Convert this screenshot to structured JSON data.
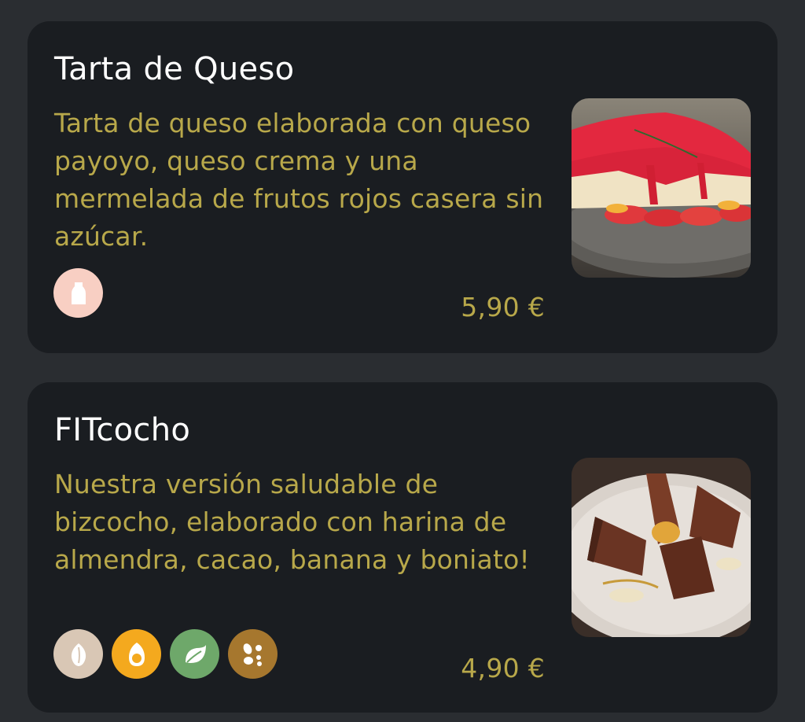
{
  "colors": {
    "page_background": "#2a2d31",
    "card_background": "#1a1d21",
    "title": "#ffffff",
    "accent": "#b8a84a"
  },
  "products": [
    {
      "title": "Tarta de Queso",
      "description": "Tarta de queso elaborada con queso payoyo, queso crema y una mermelada de frutos rojos casera sin azúcar.",
      "price": "5,90 €",
      "image": "cheesecake-photo",
      "allergens": [
        {
          "icon": "milk-bottle-icon",
          "color": "#f8cfc3"
        }
      ]
    },
    {
      "title": "FITcocho",
      "description": "Nuestra versión saludable de bizcocho, elaborado con harina de almendra, cacao, banana y boniato!",
      "price": "4,90 €",
      "image": "chocolate-sponge-cake-photo",
      "allergens": [
        {
          "icon": "nut-icon",
          "color": "#d9c7b5"
        },
        {
          "icon": "egg-icon",
          "color": "#f4a91e"
        },
        {
          "icon": "leaf-icon",
          "color": "#6ea86a"
        },
        {
          "icon": "seeds-icon",
          "color": "#a6772e"
        }
      ]
    }
  ]
}
